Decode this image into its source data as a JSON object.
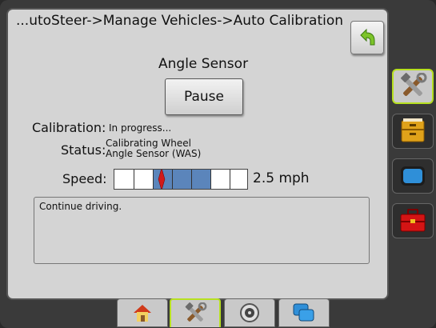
{
  "header": {
    "breadcrumb": "...utoSteer->Manage Vehicles->Auto Calibration",
    "back_icon": "back-arrow-icon"
  },
  "calibration": {
    "section_title": "Angle Sensor",
    "pause_label": "Pause",
    "calibration_label": "Calibration:",
    "calibration_value": "In progress...",
    "status_label": "Status:",
    "status_value_line1": "Calibrating Wheel",
    "status_value_line2": "Angle Sensor (WAS)",
    "speed_label": "Speed:",
    "speed_value": "2.5 mph",
    "message": "Continue driving."
  },
  "sidebar": {
    "items": [
      {
        "icon": "tools-icon",
        "active": true
      },
      {
        "icon": "file-cabinet-icon",
        "active": false
      },
      {
        "icon": "console-screen-icon",
        "active": false
      },
      {
        "icon": "toolbox-icon",
        "active": false
      }
    ]
  },
  "bottom_nav": {
    "tabs": [
      {
        "icon": "home-icon",
        "active": false
      },
      {
        "icon": "tools-icon",
        "active": true
      },
      {
        "icon": "gps-dial-icon",
        "active": false
      },
      {
        "icon": "screens-icon",
        "active": false
      }
    ]
  },
  "colors": {
    "accent": "#b7e020",
    "speed_fill": "#5b85bb",
    "needle": "#d11a1a"
  }
}
